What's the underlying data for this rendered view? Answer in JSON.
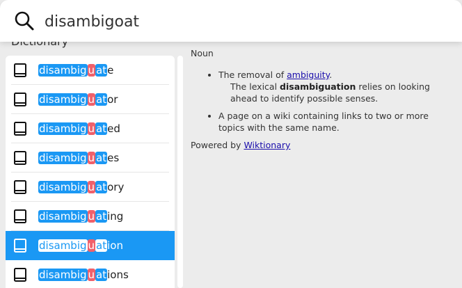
{
  "search": {
    "value": "disambigoat",
    "placeholder": ""
  },
  "results_section": {
    "title": "Dictionary"
  },
  "results": [
    {
      "pre": "disambig",
      "mid": "u",
      "post": "at",
      "rest": "e",
      "selected": false
    },
    {
      "pre": "disambig",
      "mid": "u",
      "post": "at",
      "rest": "or",
      "selected": false
    },
    {
      "pre": "disambig",
      "mid": "u",
      "post": "at",
      "rest": "ed",
      "selected": false
    },
    {
      "pre": "disambig",
      "mid": "u",
      "post": "at",
      "rest": "es",
      "selected": false
    },
    {
      "pre": "disambig",
      "mid": "u",
      "post": "at",
      "rest": "ory",
      "selected": false
    },
    {
      "pre": "disambig",
      "mid": "u",
      "post": "at",
      "rest": "ing",
      "selected": false
    },
    {
      "pre": "disambig",
      "mid": "u",
      "post": "at",
      "rest": "ion",
      "selected": true
    },
    {
      "pre": "disambig",
      "mid": "u",
      "post": "at",
      "rest": "ions",
      "selected": false
    }
  ],
  "definition": {
    "part_of_speech": "Noun",
    "sense1_prefix": "The removal of ",
    "sense1_link": "ambiguity",
    "sense1_suffix": ".",
    "example_prefix": "The lexical ",
    "example_bold": "disambiguation",
    "example_suffix": " relies on looking ahead to identify possible senses.",
    "sense2": "A page on a wiki containing links to two or more topics with the same name.",
    "powered_prefix": "Powered by ",
    "powered_link": "Wiktionary"
  },
  "colors": {
    "accent": "#1a98f4",
    "mismatch": "#f0606a"
  },
  "icons": {
    "search": "search-icon",
    "entry": "book-icon"
  }
}
